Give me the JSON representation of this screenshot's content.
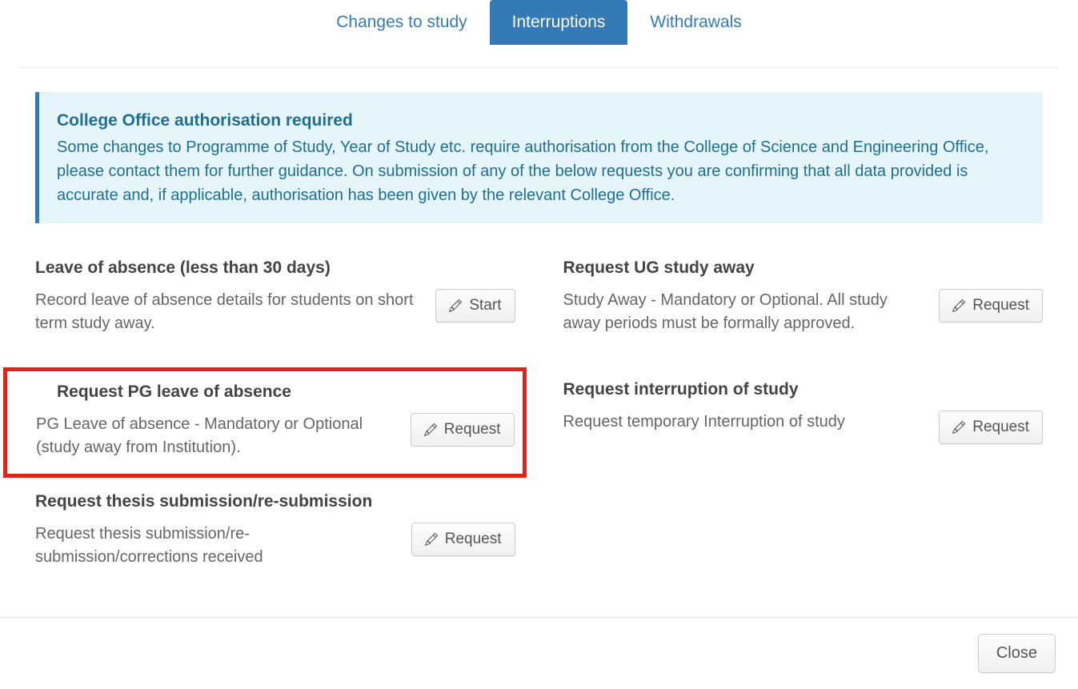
{
  "tabs": {
    "changes": "Changes to study",
    "interruptions": "Interruptions",
    "withdrawals": "Withdrawals"
  },
  "alert": {
    "title": "College Office authorisation required",
    "body": "Some changes to Programme of Study, Year of Study etc. require authorisation from the College of Science and Engineering Office, please contact them for further guidance. On submission of any of the below requests you are confirming that all data provided is accurate and, if applicable, authorisation has been given by the relevant College Office."
  },
  "cards": {
    "leave_of_absence": {
      "title": "Leave of absence (less than 30 days)",
      "desc": "Record leave of absence details for students on short term study away.",
      "button": "Start"
    },
    "pg_leave": {
      "title": "Request PG leave of absence",
      "desc": "PG Leave of absence - Mandatory or Optional (study away from Institution).",
      "button": "Request"
    },
    "thesis": {
      "title": "Request thesis submission/re-submission",
      "desc": "Request thesis submission/re-submission/corrections received",
      "button": "Request"
    },
    "ug_study_away": {
      "title": "Request UG study away",
      "desc": "Study Away - Mandatory or Optional. All study away periods must be formally approved.",
      "button": "Request"
    },
    "interruption": {
      "title": "Request interruption of study",
      "desc": "Request temporary Interruption of study",
      "button": "Request"
    }
  },
  "footer": {
    "close": "Close"
  }
}
